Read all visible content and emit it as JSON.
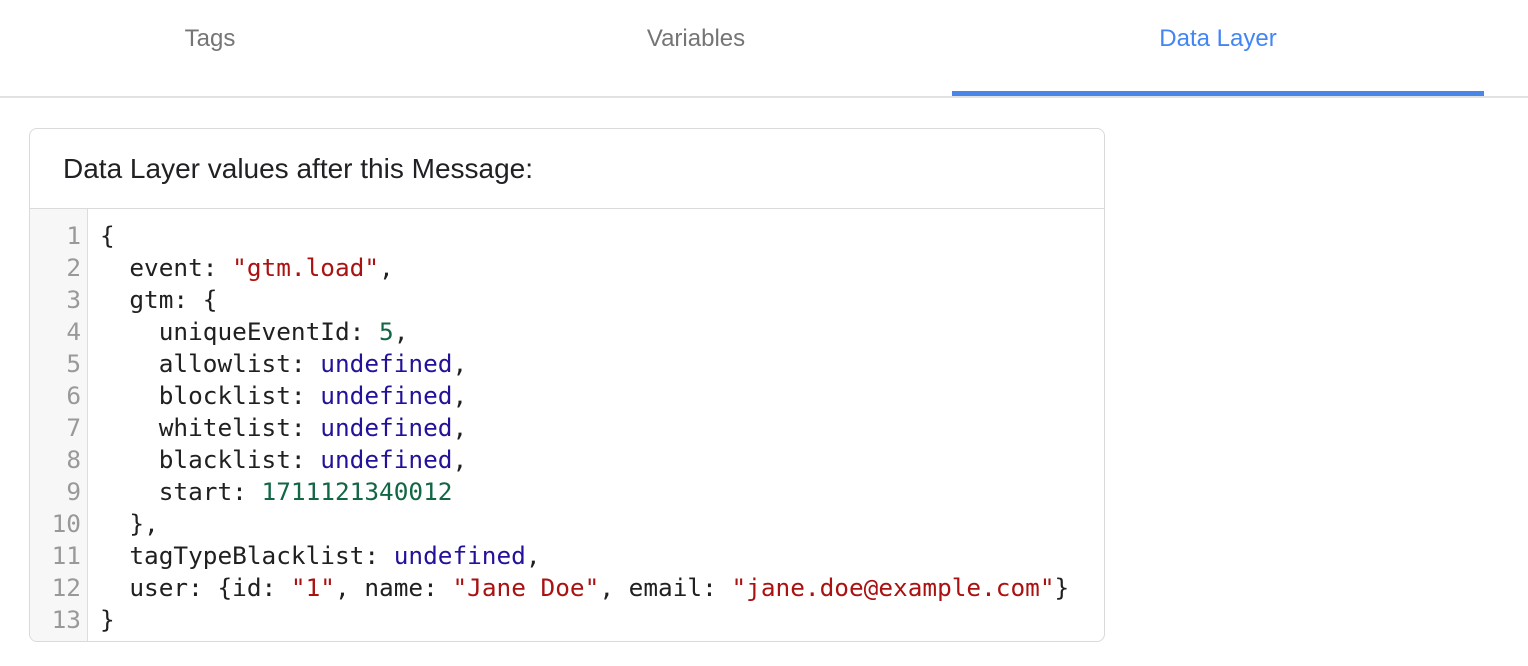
{
  "tabs": {
    "tags": "Tags",
    "variables": "Variables",
    "data_layer": "Data Layer"
  },
  "active_tab": "Data Layer",
  "card": {
    "title": "Data Layer values after this Message:"
  },
  "code": {
    "lines": [
      {
        "n": "1",
        "indent": "",
        "segments": [
          [
            "p",
            "{"
          ]
        ]
      },
      {
        "n": "2",
        "indent": "  ",
        "segments": [
          [
            "p",
            "event: "
          ],
          [
            "s",
            "\"gtm.load\""
          ],
          [
            "p",
            ","
          ]
        ]
      },
      {
        "n": "3",
        "indent": "  ",
        "segments": [
          [
            "p",
            "gtm: {"
          ]
        ]
      },
      {
        "n": "4",
        "indent": "    ",
        "segments": [
          [
            "p",
            "uniqueEventId: "
          ],
          [
            "n",
            "5"
          ],
          [
            "p",
            ","
          ]
        ]
      },
      {
        "n": "5",
        "indent": "    ",
        "segments": [
          [
            "p",
            "allowlist: "
          ],
          [
            "a",
            "undefined"
          ],
          [
            "p",
            ","
          ]
        ]
      },
      {
        "n": "6",
        "indent": "    ",
        "segments": [
          [
            "p",
            "blocklist: "
          ],
          [
            "a",
            "undefined"
          ],
          [
            "p",
            ","
          ]
        ]
      },
      {
        "n": "7",
        "indent": "    ",
        "segments": [
          [
            "p",
            "whitelist: "
          ],
          [
            "a",
            "undefined"
          ],
          [
            "p",
            ","
          ]
        ]
      },
      {
        "n": "8",
        "indent": "    ",
        "segments": [
          [
            "p",
            "blacklist: "
          ],
          [
            "a",
            "undefined"
          ],
          [
            "p",
            ","
          ]
        ]
      },
      {
        "n": "9",
        "indent": "    ",
        "segments": [
          [
            "p",
            "start: "
          ],
          [
            "n",
            "1711121340012"
          ]
        ]
      },
      {
        "n": "10",
        "indent": "  ",
        "segments": [
          [
            "p",
            "},"
          ]
        ]
      },
      {
        "n": "11",
        "indent": "  ",
        "segments": [
          [
            "p",
            "tagTypeBlacklist: "
          ],
          [
            "a",
            "undefined"
          ],
          [
            "p",
            ","
          ]
        ]
      },
      {
        "n": "12",
        "indent": "  ",
        "segments": [
          [
            "p",
            "user: {id: "
          ],
          [
            "s",
            "\"1\""
          ],
          [
            "p",
            ", name: "
          ],
          [
            "s",
            "\"Jane Doe\""
          ],
          [
            "p",
            ", email: "
          ],
          [
            "s",
            "\"jane.doe@example.com\""
          ],
          [
            "p",
            "}"
          ]
        ]
      },
      {
        "n": "13",
        "indent": "",
        "segments": [
          [
            "p",
            "}"
          ]
        ]
      }
    ]
  },
  "colors": {
    "accent": "#4285f4",
    "string": "#a11",
    "number": "#164",
    "atom": "#219"
  }
}
